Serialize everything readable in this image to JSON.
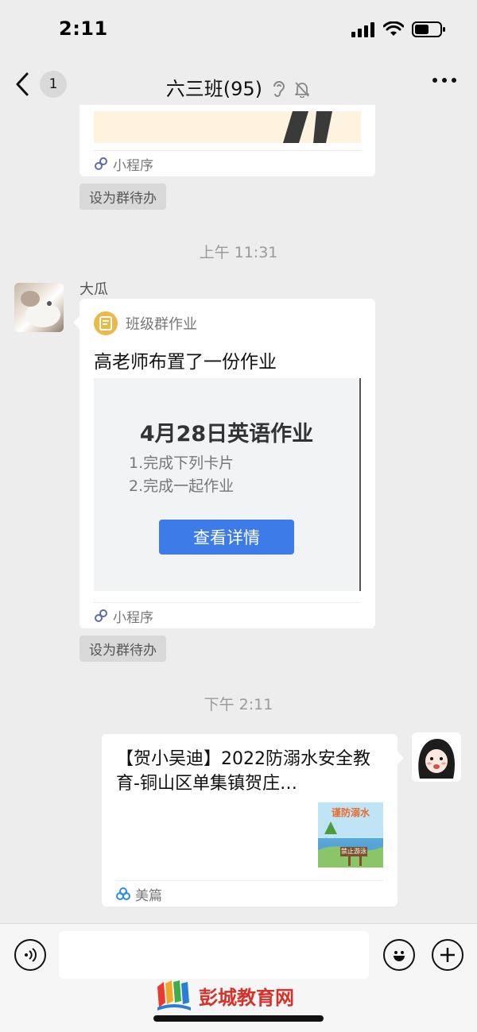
{
  "status_bar": {
    "time": "2:11"
  },
  "nav": {
    "unread_count": "1",
    "title": "六三班(95)"
  },
  "messages": {
    "top_card": {
      "source_label": "小程序",
      "action_chip": "设为群待办"
    },
    "time_1": "上午 11:31",
    "homework": {
      "sender": "大瓜",
      "app_name": "班级群作业",
      "headline": "高老师布置了一份作业",
      "preview_title": "4月28日英语作业",
      "preview_items": [
        "1.完成下列卡片",
        "2.完成一起作业"
      ],
      "preview_button": "查看详情",
      "source_label": "小程序",
      "action_chip": "设为群待办"
    },
    "time_2": "下午 2:11",
    "article": {
      "title": "【贺小吴迪】2022防溺水安全教育-铜山区单集镇贺庄…",
      "thumb_title": "谨防溺水",
      "thumb_sign": "禁止游泳",
      "source_label": "美篇"
    }
  },
  "watermark": {
    "text": "彭城教育网"
  },
  "colors": {
    "primary_button": "#3d7be8",
    "page_bg": "#ededed",
    "homework_icon": "#e9b94a"
  }
}
